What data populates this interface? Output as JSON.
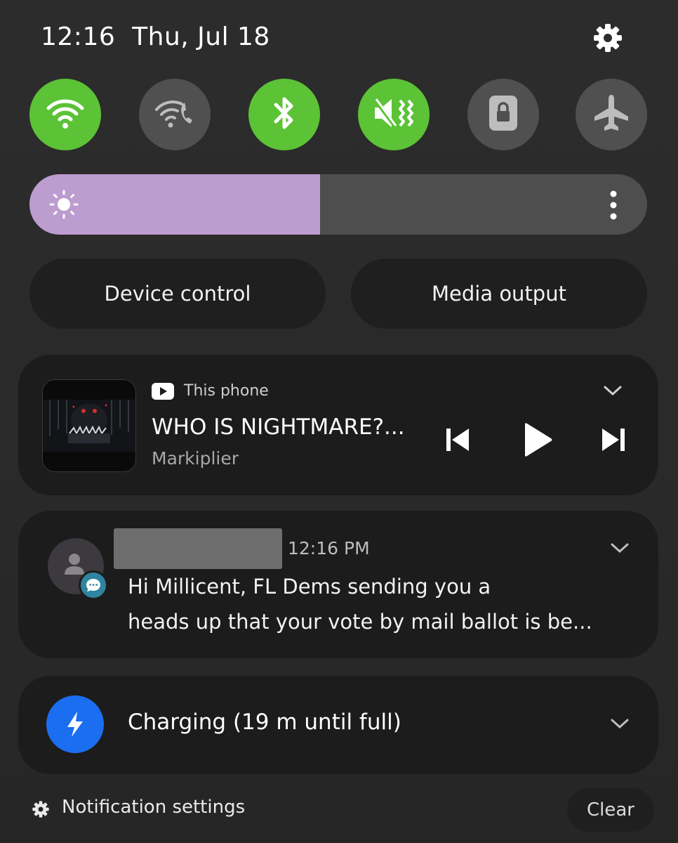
{
  "status": {
    "time": "12:16",
    "date": "Thu, Jul 18",
    "settings_icon": "gear-icon"
  },
  "quick_toggles": [
    {
      "name": "wifi",
      "icon": "wifi-icon",
      "state": "on"
    },
    {
      "name": "wifi-calling",
      "icon": "wifi-calling-icon",
      "state": "off"
    },
    {
      "name": "bluetooth",
      "icon": "bluetooth-icon",
      "state": "on"
    },
    {
      "name": "vibrate",
      "icon": "vibrate-icon",
      "state": "on"
    },
    {
      "name": "screen-lock",
      "icon": "lock-icon",
      "state": "off"
    },
    {
      "name": "airplane-mode",
      "icon": "airplane-icon",
      "state": "off"
    }
  ],
  "brightness": {
    "level": 0.47,
    "icon": "sun-icon",
    "more_icon": "more-vertical-icon"
  },
  "buttons": {
    "device_control": "Device control",
    "media_output": "Media output"
  },
  "media": {
    "source": "This phone",
    "title": "WHO IS NIGHTMARE?...",
    "artist": "Markiplier",
    "app_icon": "youtube-icon"
  },
  "message": {
    "time": "12:16 PM",
    "line1": "Hi Millicent, FL Dems sending you a",
    "line2": "heads up that your vote by mail ballot is be..."
  },
  "charging": {
    "text": "Charging (19 m until full)",
    "icon": "lightning-icon"
  },
  "footer": {
    "notification_settings": "Notification settings",
    "clear": "Clear"
  },
  "colors": {
    "toggle_on": "#5cc236",
    "toggle_off": "#505050",
    "brightness_fill": "#bd9ccf",
    "charging_icon_bg": "#1b6ef0",
    "message_badge": "#2f84a0"
  }
}
